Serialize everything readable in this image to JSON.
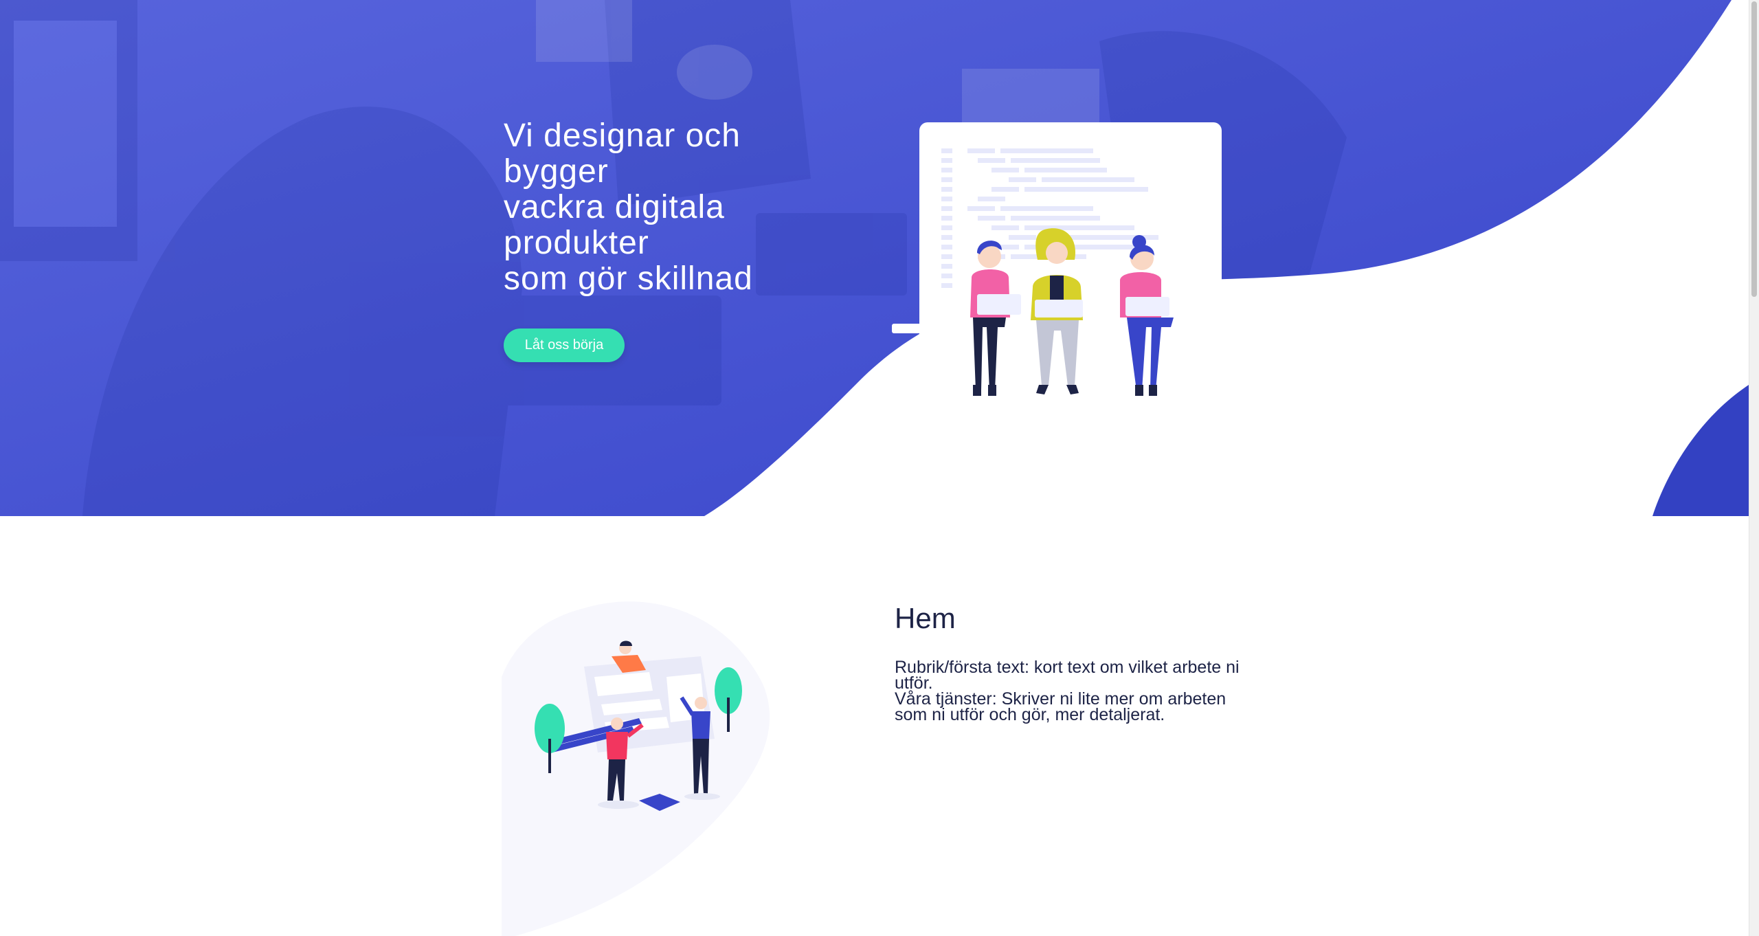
{
  "hero": {
    "title_lines": [
      "Vi designar och",
      "bygger",
      "vackra digitala",
      "produkter",
      "som gör skillnad"
    ],
    "cta_label": "Låt oss börja",
    "colors": {
      "overlay": "#3f4fd6",
      "wave": "#3341c2",
      "cta": "#35dfb2"
    }
  },
  "home": {
    "title": "Hem",
    "paragraph_1": "Rubrik/första text: kort text om vilket arbete ni utför.",
    "paragraph_2": "Våra tjänster: Skriver ni lite mer om arbeten som ni utför och gör, mer detaljerat."
  },
  "icons": {
    "hero_illustration": "team-with-laptops-illustration",
    "home_illustration": "team-building-ui-illustration"
  }
}
